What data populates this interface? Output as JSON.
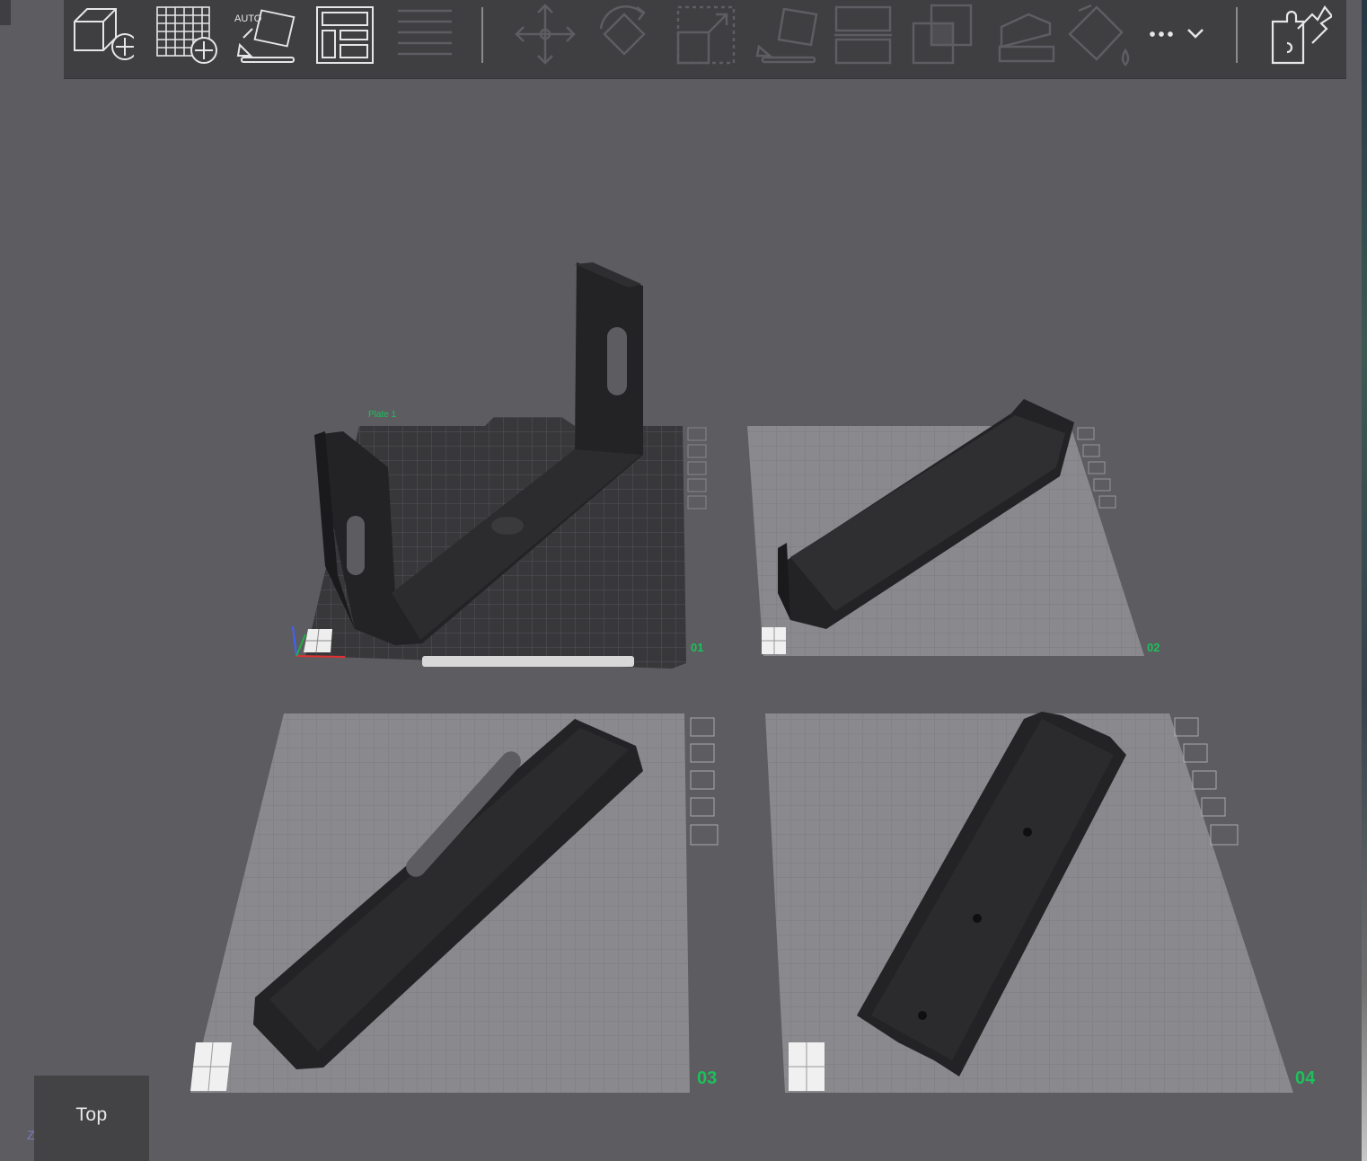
{
  "toolbar": {
    "buttons": [
      {
        "name": "add-object",
        "icon": "cube-plus-icon",
        "enabled": true
      },
      {
        "name": "add-plate",
        "icon": "grid-plus-icon",
        "enabled": true
      },
      {
        "name": "auto-orient",
        "icon": "auto-orient-icon",
        "label": "AUTO",
        "enabled": true
      },
      {
        "name": "arrange",
        "icon": "arrange-icon",
        "enabled": true
      },
      {
        "name": "split-layers",
        "icon": "lines-icon",
        "enabled": false
      },
      {
        "name": "move",
        "icon": "move-arrows-icon",
        "enabled": false
      },
      {
        "name": "rotate",
        "icon": "rotate-icon",
        "enabled": false
      },
      {
        "name": "scale",
        "icon": "scale-icon",
        "enabled": false
      },
      {
        "name": "lay-on-face",
        "icon": "lay-on-face-icon",
        "enabled": false
      },
      {
        "name": "cut",
        "icon": "cut-icon",
        "enabled": false
      },
      {
        "name": "boolean",
        "icon": "boolean-icon",
        "enabled": false
      },
      {
        "name": "support-paint",
        "icon": "support-paint-icon",
        "enabled": false
      },
      {
        "name": "color-paint",
        "icon": "paint-bucket-icon",
        "enabled": false
      },
      {
        "name": "more",
        "icon": "more-dots-icon",
        "enabled": true
      },
      {
        "name": "assembly",
        "icon": "puzzle-icon",
        "enabled": true
      }
    ]
  },
  "plates": [
    {
      "number": "01",
      "name": "Plate 1",
      "active": true
    },
    {
      "number": "02",
      "name": "",
      "active": false
    },
    {
      "number": "03",
      "name": "",
      "active": false
    },
    {
      "number": "04",
      "name": "",
      "active": false
    }
  ],
  "view": {
    "label": "Top",
    "axis": "Z"
  },
  "colors": {
    "accent": "#1dc05a",
    "background": "#5c5c61",
    "toolbar": "#3f3f42"
  }
}
